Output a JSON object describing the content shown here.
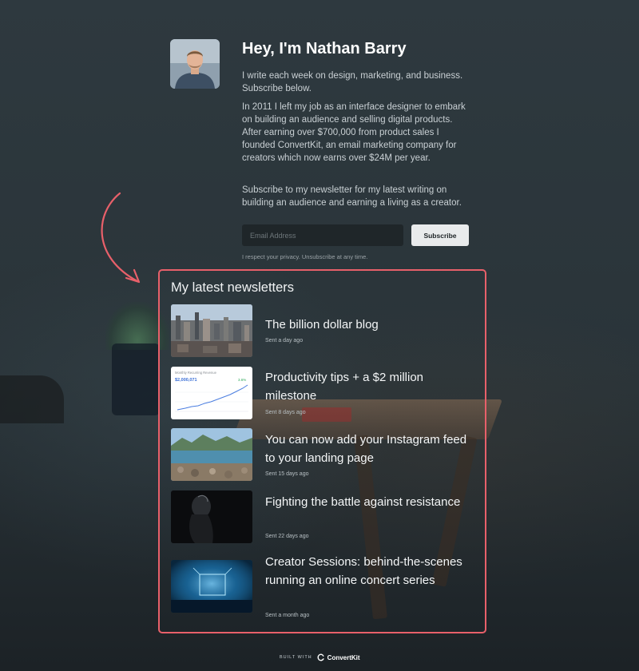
{
  "hero": {
    "title": "Hey, I'm Nathan Barry",
    "paragraph1": "I write each week on design, marketing, and business. Subscribe below.",
    "paragraph2": "In 2011 I left my job as an interface designer to embark on building an audience and selling digital products. After earning over $700,000 from product sales I founded ConvertKit, an email marketing company for creators which now earns over $24M per year.",
    "paragraph3": "Subscribe to my newsletter for my latest writing on building an audience and earning a living as a creator."
  },
  "form": {
    "email_placeholder": "Email Address",
    "email_value": "",
    "subscribe_label": "Subscribe",
    "privacy_note": "I respect your privacy. Unsubscribe at any time."
  },
  "newsletters": {
    "heading": "My latest newsletters",
    "items": [
      {
        "title": "The billion dollar blog",
        "sent": "Sent a day ago",
        "thumb_icon": "city-skyline-thumbnail"
      },
      {
        "title": "Productivity tips + a $2 million milestone",
        "sent": "Sent 8 days ago",
        "thumb_icon": "revenue-chart-thumbnail",
        "thumb_text": {
          "chart_title": "Monthly Recurring Revenue",
          "chart_value": "$2,000,071",
          "chart_change": "3.6%"
        }
      },
      {
        "title": "You can now add your Instagram feed to your landing page",
        "sent": "Sent 15 days ago",
        "thumb_icon": "lake-mountains-thumbnail"
      },
      {
        "title": "Fighting the battle against resistance",
        "sent": "Sent 22 days ago",
        "thumb_icon": "dark-figure-thumbnail"
      },
      {
        "title": "Creator Sessions: behind-the-scenes running an online concert series",
        "sent": "Sent a month ago",
        "thumb_icon": "concert-stage-thumbnail"
      }
    ]
  },
  "footer": {
    "built_with": "BUILT WITH",
    "brand": "ConvertKit"
  },
  "colors": {
    "accent_border": "#e8606a",
    "background": "#2b353b",
    "button_bg": "#e9ebec"
  }
}
